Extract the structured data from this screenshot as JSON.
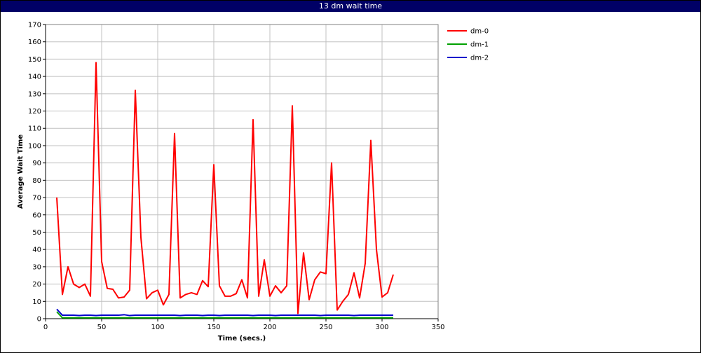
{
  "window": {
    "title": "13 dm wait time"
  },
  "chart_data": {
    "type": "line",
    "title": "13 dm wait time",
    "xlabel": "Time (secs.)",
    "ylabel": "Average Wait Time",
    "xlim": [
      0,
      350
    ],
    "ylim": [
      0,
      170
    ],
    "xticks": [
      0,
      50,
      100,
      150,
      200,
      250,
      300,
      350
    ],
    "yticks": [
      0,
      10,
      20,
      30,
      40,
      50,
      60,
      70,
      80,
      90,
      100,
      110,
      120,
      130,
      140,
      150,
      160,
      170
    ],
    "grid": true,
    "legend_position": "top-right outside",
    "series": [
      {
        "name": "dm-0",
        "color": "#ff0000",
        "x": [
          10,
          15,
          20,
          25,
          30,
          35,
          40,
          45,
          50,
          55,
          60,
          65,
          70,
          75,
          80,
          85,
          90,
          95,
          100,
          105,
          110,
          115,
          120,
          125,
          130,
          135,
          140,
          145,
          150,
          155,
          160,
          165,
          170,
          175,
          180,
          185,
          190,
          195,
          200,
          205,
          210,
          215,
          220,
          225,
          230,
          235,
          240,
          245,
          250,
          255,
          260,
          265,
          270,
          275,
          280,
          285,
          290,
          295,
          300,
          305,
          310
        ],
        "y": [
          70,
          14,
          30,
          20,
          18,
          20,
          13,
          148,
          33,
          17.5,
          17,
          12,
          12.5,
          16.5,
          132,
          47,
          11.5,
          15,
          16.5,
          8,
          14,
          107,
          12,
          14,
          15,
          14,
          22,
          18.5,
          89,
          19,
          13,
          13,
          14.5,
          22.5,
          12,
          115,
          13,
          34,
          13,
          19,
          15,
          19,
          123,
          3,
          38,
          11,
          22.5,
          27,
          26,
          90,
          5,
          10,
          14,
          26.5,
          12,
          32,
          103,
          40,
          12.5,
          15,
          25.5
        ]
      },
      {
        "name": "dm-1",
        "color": "#00a000",
        "x": [
          10,
          15,
          20,
          310
        ],
        "y": [
          4,
          0.5,
          0.5,
          0.5
        ]
      },
      {
        "name": "dm-2",
        "color": "#0000cc",
        "x": [
          10,
          15,
          20,
          25,
          30,
          35,
          40,
          45,
          50,
          55,
          60,
          65,
          70,
          75,
          80,
          85,
          90,
          95,
          100,
          105,
          110,
          115,
          120,
          125,
          130,
          135,
          140,
          145,
          150,
          155,
          160,
          165,
          170,
          175,
          180,
          185,
          190,
          195,
          200,
          205,
          210,
          215,
          220,
          225,
          230,
          235,
          240,
          245,
          250,
          255,
          260,
          265,
          270,
          275,
          280,
          285,
          290,
          295,
          300,
          305,
          310
        ],
        "y": [
          5.5,
          2,
          2,
          2,
          1.8,
          2,
          2,
          1.8,
          2,
          2,
          2,
          2,
          2.3,
          1.8,
          2,
          2,
          2,
          2,
          2,
          2,
          2,
          2,
          1.8,
          2,
          2,
          2,
          1.8,
          2,
          2,
          1.8,
          2,
          2,
          2,
          2,
          2,
          1.8,
          2,
          2,
          2,
          1.8,
          2,
          2,
          2,
          2,
          2,
          2,
          2,
          1.8,
          2,
          2,
          2,
          2,
          2,
          1.8,
          2,
          2,
          2,
          2,
          2,
          2,
          2
        ]
      }
    ]
  }
}
